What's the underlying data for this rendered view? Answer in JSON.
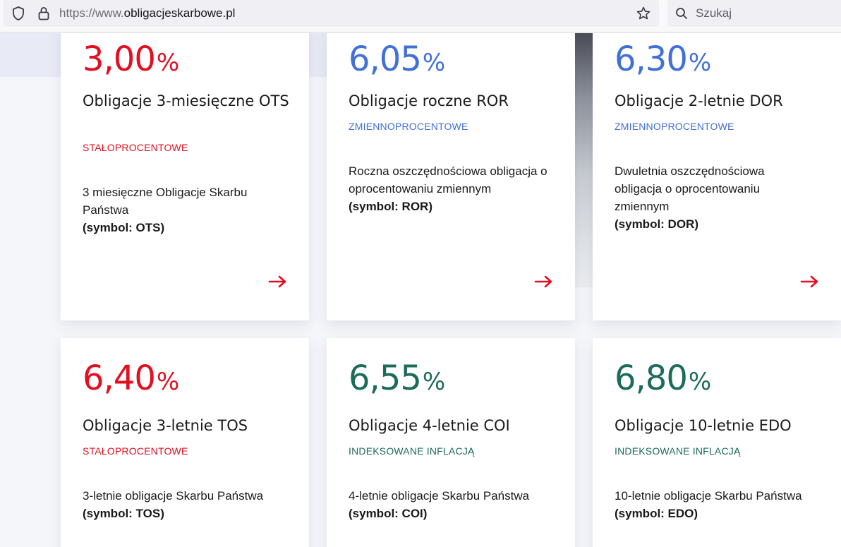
{
  "browser": {
    "url_prefix": "https://www.",
    "url_domain": "obligacjeskarbowe.pl",
    "search_placeholder": "Szukaj"
  },
  "colors": {
    "fixed": "#e30e1f",
    "variable": "#4170d8",
    "inflation": "#1d6b5a"
  },
  "cards": [
    {
      "rate": "3,00",
      "percent": "%",
      "title": "Obligacje 3-miesięczne OTS",
      "kind": "STAŁOPROCENTOWE",
      "description": "3 miesięczne Obligacje Skarbu Państwa",
      "symbol": "(symbol: OTS)",
      "arrow": "arrow-right-icon"
    },
    {
      "rate": "6,05",
      "percent": "%",
      "title": "Obligacje roczne ROR",
      "kind": "ZMIENNOPROCENTOWE",
      "description": "Roczna oszczędnościowa obligacja o oprocentowaniu zmiennym",
      "symbol": "(symbol: ROR)",
      "arrow": "arrow-right-icon"
    },
    {
      "rate": "6,30",
      "percent": "%",
      "title": "Obligacje 2-letnie DOR",
      "kind": "ZMIENNOPROCENTOWE",
      "description": "Dwuletnia oszczędnościowa obligacja o oprocentowaniu zmiennym",
      "symbol": "(symbol: DOR)",
      "arrow": "arrow-right-icon"
    },
    {
      "rate": "6,40",
      "percent": "%",
      "title": "Obligacje 3-letnie TOS",
      "kind": "STAŁOPROCENTOWE",
      "description": "3-letnie obligacje Skarbu Państwa",
      "symbol": "(symbol: TOS)"
    },
    {
      "rate": "6,55",
      "percent": "%",
      "title": "Obligacje 4-letnie COI",
      "kind": "INDEKSOWANE INFLACJĄ",
      "description": "4-letnie obligacje Skarbu Państwa",
      "symbol": "(symbol: COI)"
    },
    {
      "rate": "6,80",
      "percent": "%",
      "title": "Obligacje 10-letnie EDO",
      "kind": "INDEKSOWANE INFLACJĄ",
      "description": "10-letnie obligacje Skarbu Państwa",
      "symbol": "(symbol: EDO)"
    }
  ]
}
